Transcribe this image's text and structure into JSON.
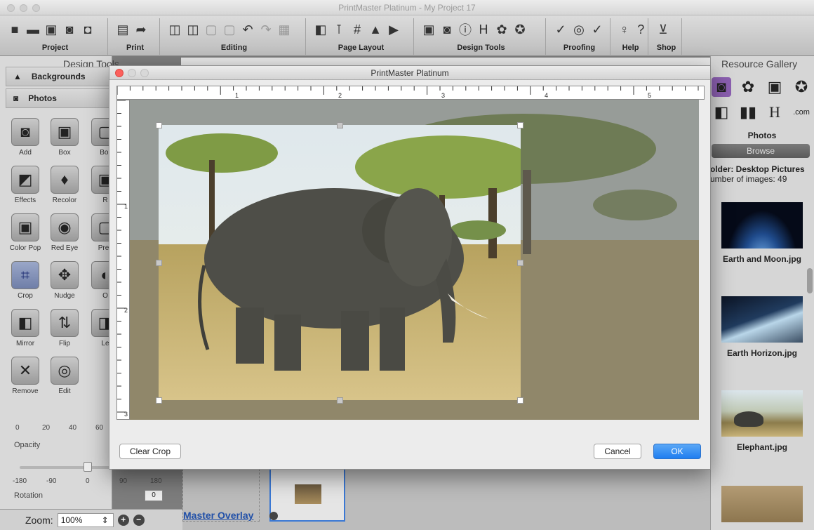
{
  "window": {
    "title": "PrintMaster Platinum - My Project 17"
  },
  "toolbar": {
    "groups": [
      {
        "label": "Project"
      },
      {
        "label": "Print"
      },
      {
        "label": "Editing"
      },
      {
        "label": "Page Layout"
      },
      {
        "label": "Design Tools"
      },
      {
        "label": "Proofing"
      },
      {
        "label": "Help"
      },
      {
        "label": "Shop"
      }
    ]
  },
  "left_panel": {
    "title": "Design Tools",
    "backgrounds_label": "Backgrounds",
    "photos_label": "Photos",
    "tools": [
      {
        "label": "Add",
        "icon": "camera-icon"
      },
      {
        "label": "Box",
        "icon": "person-box-icon"
      },
      {
        "label": "Bor",
        "icon": "border-icon"
      },
      {
        "label": "Effects",
        "icon": "effects-icon"
      },
      {
        "label": "Recolor",
        "icon": "recolor-icon"
      },
      {
        "label": "R",
        "icon": "r-icon"
      },
      {
        "label": "Color Pop",
        "icon": "colorpop-icon"
      },
      {
        "label": "Red Eye",
        "icon": "eye-icon"
      },
      {
        "label": "Prev",
        "icon": "preview-icon"
      },
      {
        "label": "Crop",
        "icon": "crop-icon"
      },
      {
        "label": "Nudge",
        "icon": "nudge-icon"
      },
      {
        "label": "O",
        "icon": "o-icon"
      },
      {
        "label": "Mirror",
        "icon": "mirror-icon"
      },
      {
        "label": "Flip",
        "icon": "flip-icon"
      },
      {
        "label": "Le",
        "icon": "le-icon"
      },
      {
        "label": "Remove",
        "icon": "remove-icon"
      },
      {
        "label": "Edit",
        "icon": "edit-icon"
      }
    ],
    "opacity": {
      "label": "Opacity",
      "ticks": [
        "0",
        "20",
        "40",
        "60"
      ]
    },
    "rotation": {
      "label": "Rotation",
      "ticks": [
        "-180",
        "-90",
        "0",
        "90",
        "180"
      ],
      "value": "0"
    },
    "zoom": {
      "label": "Zoom:",
      "value": "100%"
    }
  },
  "right_panel": {
    "title": "Resource Gallery",
    "section": "Photos",
    "browse_label": "Browse",
    "folder": "older: Desktop Pictures",
    "count": "umber of images: 49",
    "items": [
      {
        "name": "Earth and Moon.jpg"
      },
      {
        "name": "Earth Horizon.jpg"
      },
      {
        "name": "Elephant.jpg"
      }
    ]
  },
  "canvas": {
    "master_overlay_label": "Master Overlay"
  },
  "dialog": {
    "title": "PrintMaster Platinum",
    "ruler_h_labels": [
      "1",
      "2",
      "3",
      "4",
      "5"
    ],
    "ruler_v_labels": [
      "1",
      "2",
      "3"
    ],
    "clear_crop_label": "Clear Crop",
    "cancel_label": "Cancel",
    "ok_label": "OK"
  }
}
